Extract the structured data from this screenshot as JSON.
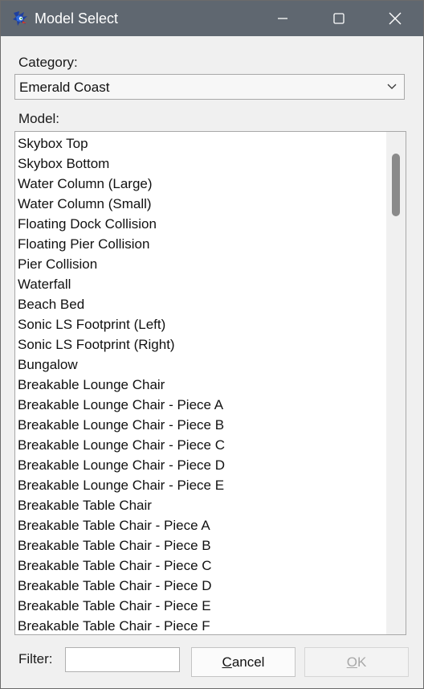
{
  "window": {
    "title": "Model Select",
    "controls": {
      "minimize": "minimize-icon",
      "maximize": "maximize-icon",
      "close": "close-icon"
    }
  },
  "category": {
    "label": "Category:",
    "selected": "Emerald Coast"
  },
  "model": {
    "label": "Model:",
    "items": [
      "Skybox Top",
      "Skybox Bottom",
      "Water Column (Large)",
      "Water Column (Small)",
      "Floating Dock Collision",
      "Floating Pier Collision",
      "Pier Collision",
      "Waterfall",
      "Beach Bed",
      "Sonic LS Footprint (Left)",
      "Sonic LS Footprint (Right)",
      "Bungalow",
      "Breakable Lounge Chair",
      "Breakable Lounge Chair - Piece A",
      "Breakable Lounge Chair - Piece B",
      "Breakable Lounge Chair - Piece C",
      "Breakable Lounge Chair - Piece D",
      "Breakable Lounge Chair - Piece E",
      "Breakable Table Chair",
      "Breakable Table Chair - Piece A",
      "Breakable Table Chair - Piece B",
      "Breakable Table Chair - Piece C",
      "Breakable Table Chair - Piece D",
      "Breakable Table Chair - Piece E",
      "Breakable Table Chair - Piece F"
    ]
  },
  "filter": {
    "label": "Filter:",
    "value": ""
  },
  "buttons": {
    "cancel": "Cancel",
    "ok": "OK"
  },
  "colors": {
    "titlebar": "#5f6770",
    "window_bg": "#f0f0f0",
    "disabled_text": "#a8a8a8"
  }
}
